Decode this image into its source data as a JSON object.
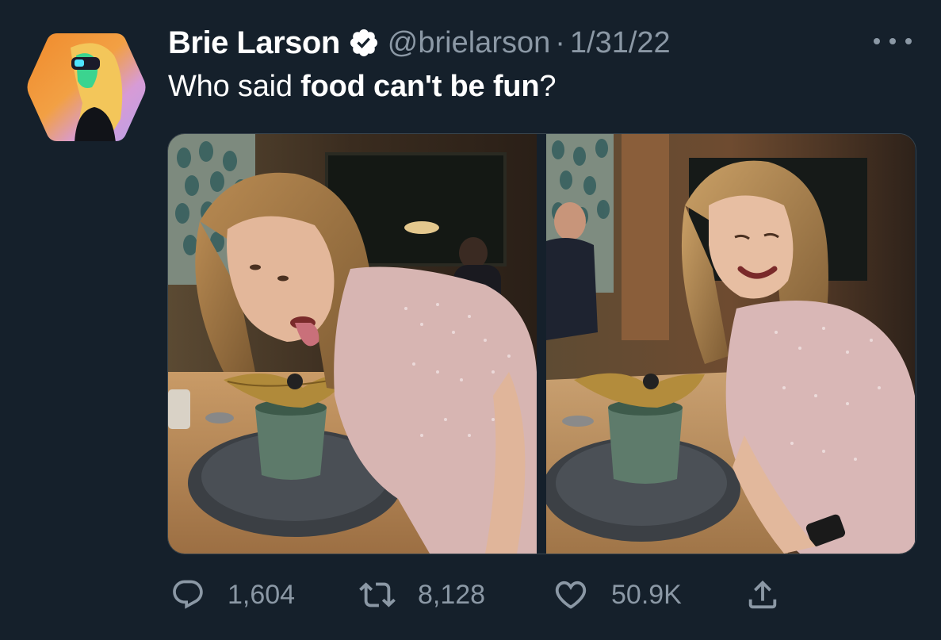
{
  "author": {
    "display_name": "Brie Larson",
    "handle": "@brielarson",
    "separator": "·",
    "date": "1/31/22",
    "verified": true
  },
  "tweet": {
    "text_part1": "Who said ",
    "text_bold": "food can't be fun",
    "text_part2": "?"
  },
  "media": {
    "photos": [
      {
        "name": "photo-left",
        "subject": "woman licking leaf dessert at restaurant table"
      },
      {
        "name": "photo-right",
        "subject": "woman laughing beside leaf dessert at restaurant table"
      }
    ]
  },
  "actions": {
    "reply_count": "1,604",
    "retweet_count": "8,128",
    "like_count": "50.9K",
    "icons": [
      "reply-icon",
      "retweet-icon",
      "like-icon",
      "share-icon"
    ]
  },
  "colors": {
    "background": "#15202b",
    "secondary_text": "#8b98a5",
    "border": "#38444d",
    "verified_badge": "#ffffff"
  }
}
